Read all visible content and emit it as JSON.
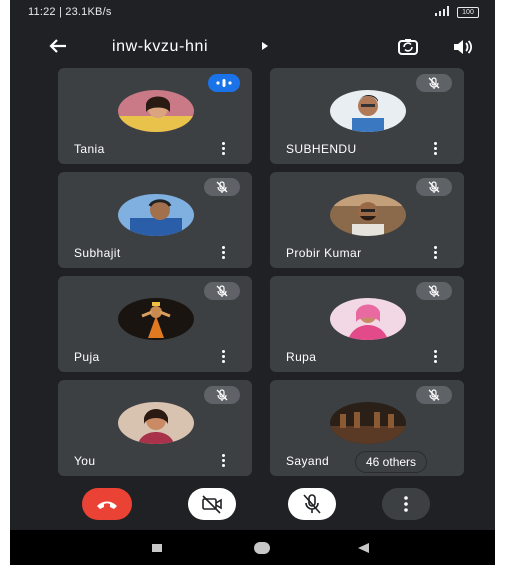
{
  "status_bar": {
    "time_and_info": "11:22 | 23.1KB/s",
    "battery": "100"
  },
  "header": {
    "meeting_code": "inw-kvzu-hni",
    "icons": [
      "back-arrow-icon",
      "switch-camera-icon",
      "speaker-icon"
    ]
  },
  "participants": [
    {
      "name": "Tania",
      "status": "speaking"
    },
    {
      "name": "SUBHENDU",
      "status": "muted"
    },
    {
      "name": "Subhajit",
      "status": "muted"
    },
    {
      "name": "Probir Kumar",
      "status": "muted"
    },
    {
      "name": "Puja",
      "status": "muted"
    },
    {
      "name": "Rupa",
      "status": "muted"
    },
    {
      "name": "You",
      "status": "muted"
    },
    {
      "name": "Sayand",
      "status": "muted"
    }
  ],
  "others_count_label": "46 others",
  "controls": [
    "end-call-icon",
    "camera-off-icon",
    "mic-off-icon",
    "more-options-icon"
  ],
  "colors": {
    "background": "#202124",
    "tile": "#3c4043",
    "end_call": "#ea4335",
    "speaking": "#1a73e8"
  }
}
